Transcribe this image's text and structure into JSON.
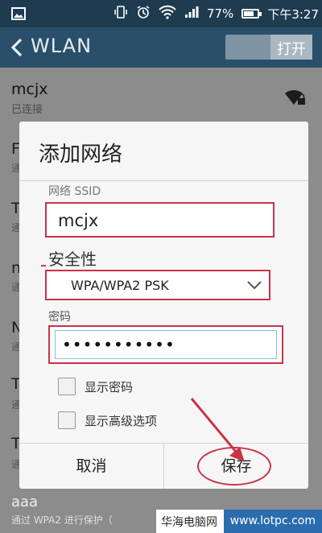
{
  "status_bar": {
    "battery_percent": "77%",
    "time": "下午3:27",
    "battery_level": 0.77
  },
  "header": {
    "back_label": "WLAN",
    "toggle_label": "打开"
  },
  "background_list": {
    "first": {
      "name": "mcjx",
      "status": "已连接"
    },
    "partial_letters": [
      "F",
      "T",
      "n",
      "N",
      "T",
      "T"
    ],
    "partial_subs": [
      "通",
      "通",
      "通",
      "通",
      "通",
      "通"
    ],
    "last": {
      "name": "aaa",
      "status": "通过 WPA2 进行保护（"
    }
  },
  "dialog": {
    "title": "添加网络",
    "ssid_label": "网络 SSID",
    "ssid_value": "mcjx",
    "security_label": "安全性",
    "security_value": "WPA/WPA2 PSK",
    "password_label": "密码",
    "password_value": "•••••••••••",
    "show_password_label": "显示密码",
    "show_advanced_label": "显示高级选项",
    "cancel_label": "取消",
    "save_label": "保存"
  },
  "watermark": {
    "left": "华海电脑网",
    "right": "www.lotpc.com"
  },
  "colors": {
    "status_bar": "#1e3b50",
    "action_bar": "#2a4f6a",
    "highlight": "#c8334a",
    "dialog_bg": "#f6f6f6"
  }
}
